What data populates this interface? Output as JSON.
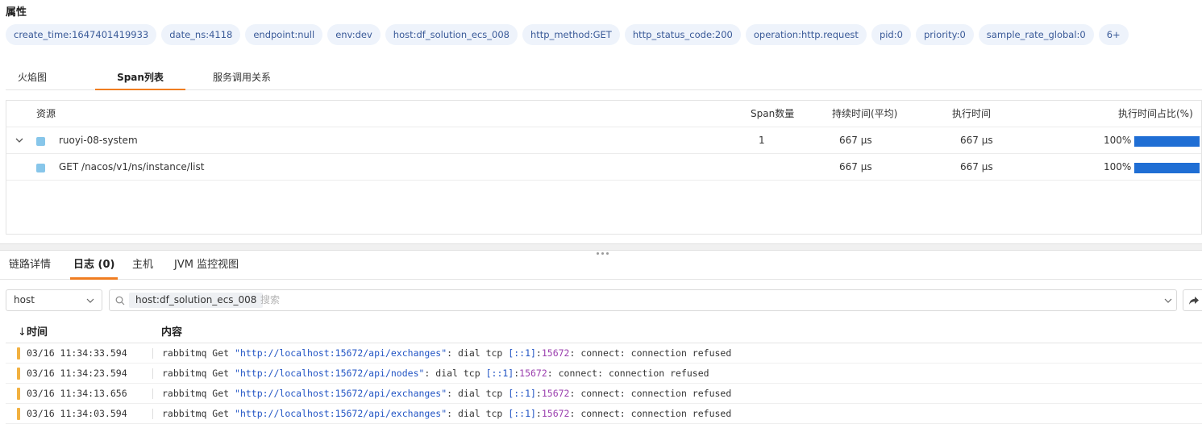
{
  "attributes": {
    "title": "属性",
    "chips": [
      "create_time:1647401419933",
      "date_ns:4118",
      "endpoint:null",
      "env:dev",
      "host:df_solution_ecs_008",
      "http_method:GET",
      "http_status_code:200",
      "operation:http.request",
      "pid:0",
      "priority:0",
      "sample_rate_global:0",
      "6+"
    ]
  },
  "view_tabs": [
    "火焰图",
    "Span列表",
    "服务调用关系"
  ],
  "view_tabs_active": "Span列表",
  "span_table": {
    "headers": {
      "resource": "资源",
      "span_count": "Span数量",
      "duration_avg": "持续时间(平均)",
      "exec_time": "执行时间",
      "exec_pct": "执行时间占比(%)"
    },
    "rows": [
      {
        "resource": "ruoyi-08-system",
        "span_count": "1",
        "duration_avg": "667 μs",
        "exec_time": "667 μs",
        "exec_pct": "100%",
        "pct_value": 100,
        "color": "#87c6ea"
      },
      {
        "resource": "GET /nacos/v1/ns/instance/list",
        "span_count": "",
        "duration_avg": "667 μs",
        "exec_time": "667 μs",
        "exec_pct": "100%",
        "pct_value": 100,
        "color": "#87c6ea"
      }
    ]
  },
  "detail_tabs": [
    "链路详情",
    "日志 (0)",
    "主机",
    "JVM 监控视图"
  ],
  "detail_tabs_active": "日志 (0)",
  "filter": {
    "field_select": "host",
    "tag": "host:df_solution_ecs_008",
    "placeholder": "搜索"
  },
  "logs": {
    "headers": {
      "time": "时间",
      "content": "内容"
    },
    "rows": [
      {
        "time": "03/16 11:34:33.594",
        "prefix": "rabbitmq Get ",
        "url": "\"http://localhost:15672/api/exchanges\"",
        "mid": ": dial tcp ",
        "addr": "[::1]",
        "colon": ":",
        "port": "15672",
        "suffix": ": connect: connection refused"
      },
      {
        "time": "03/16 11:34:23.594",
        "prefix": "rabbitmq Get ",
        "url": "\"http://localhost:15672/api/nodes\"",
        "mid": ": dial tcp ",
        "addr": "[::1]",
        "colon": ":",
        "port": "15672",
        "suffix": ": connect: connection refused"
      },
      {
        "time": "03/16 11:34:13.656",
        "prefix": "rabbitmq Get ",
        "url": "\"http://localhost:15672/api/exchanges\"",
        "mid": ": dial tcp ",
        "addr": "[::1]",
        "colon": ":",
        "port": "15672",
        "suffix": ": connect: connection refused"
      },
      {
        "time": "03/16 11:34:03.594",
        "prefix": "rabbitmq Get ",
        "url": "\"http://localhost:15672/api/exchanges\"",
        "mid": ": dial tcp ",
        "addr": "[::1]",
        "colon": ":",
        "port": "15672",
        "suffix": ": connect: connection refused"
      }
    ]
  },
  "icons": {
    "expand": "chevron-down-icon",
    "sort": "sort-arrow-down-icon",
    "search": "search-icon",
    "dropdown": "chevron-down-icon",
    "share": "share-icon"
  }
}
